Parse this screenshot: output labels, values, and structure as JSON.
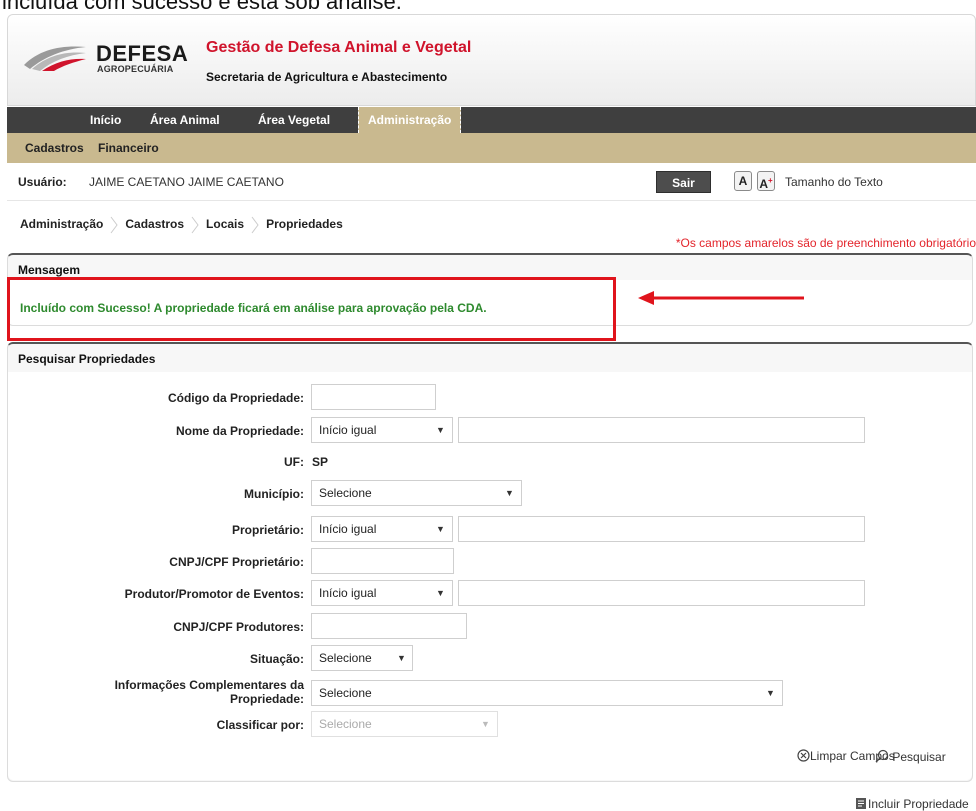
{
  "caption": "incluída com sucesso e está sob análise.",
  "logo": {
    "title": "DEFESA",
    "subtitle": "AGROPECUÁRIA"
  },
  "header": {
    "system_title": "Gestão de Defesa Animal e Vegetal",
    "system_subtitle": "Secretaria de Agricultura e Abastecimento"
  },
  "main_nav": [
    "Início",
    "Área Animal",
    "Área Vegetal",
    "Administração"
  ],
  "main_nav_active": "Administração",
  "sub_nav": [
    "Cadastros",
    "Financeiro"
  ],
  "user_bar": {
    "label": "Usuário:",
    "name": "JAIME CAETANO JAIME CAETANO",
    "logout": "Sair",
    "font_a": "A",
    "font_a_plus": "A",
    "text_size": "Tamanho do Texto"
  },
  "breadcrumb": [
    "Administração",
    "Cadastros",
    "Locais",
    "Propriedades"
  ],
  "required_note": "*Os campos amarelos são de preenchimento obrigatório",
  "message_panel": {
    "title": "Mensagem",
    "text": "Incluído com Sucesso! A propriedade ficará em análise para aprovação pela CDA."
  },
  "search": {
    "title": "Pesquisar Propriedades",
    "fields": {
      "codigo": {
        "label": "Código da Propriedade:",
        "value": ""
      },
      "nome": {
        "label": "Nome da Propriedade:",
        "mode": "Início igual",
        "value": ""
      },
      "uf": {
        "label": "UF:",
        "value": "SP"
      },
      "municipio": {
        "label": "Município:",
        "value": "Selecione"
      },
      "proprietario": {
        "label": "Proprietário:",
        "mode": "Início igual",
        "value": ""
      },
      "cnpj_proprietario": {
        "label": "CNPJ/CPF Proprietário:",
        "value": ""
      },
      "produtor": {
        "label": "Produtor/Promotor de Eventos:",
        "mode": "Início igual",
        "value": ""
      },
      "cnpj_produtores": {
        "label": "CNPJ/CPF Produtores:",
        "value": ""
      },
      "situacao": {
        "label": "Situação:",
        "value": "Selecione"
      },
      "info_complementares": {
        "label_line1": "Informações Complementares da",
        "label_line2": "Propriedade:",
        "value": "Selecione"
      },
      "classificar": {
        "label": "Classificar por:",
        "value": "Selecione"
      }
    },
    "clear_label": "Limpar Campos",
    "search_label": "Pesquisar"
  },
  "include_label": "Incluir Propriedade",
  "colors": {
    "brand_red": "#d0142c",
    "nav_dark": "#3f3f3f",
    "nav_tan": "#c9b98f",
    "success_green": "#2e8a2e",
    "highlight_red": "#e0141c"
  }
}
